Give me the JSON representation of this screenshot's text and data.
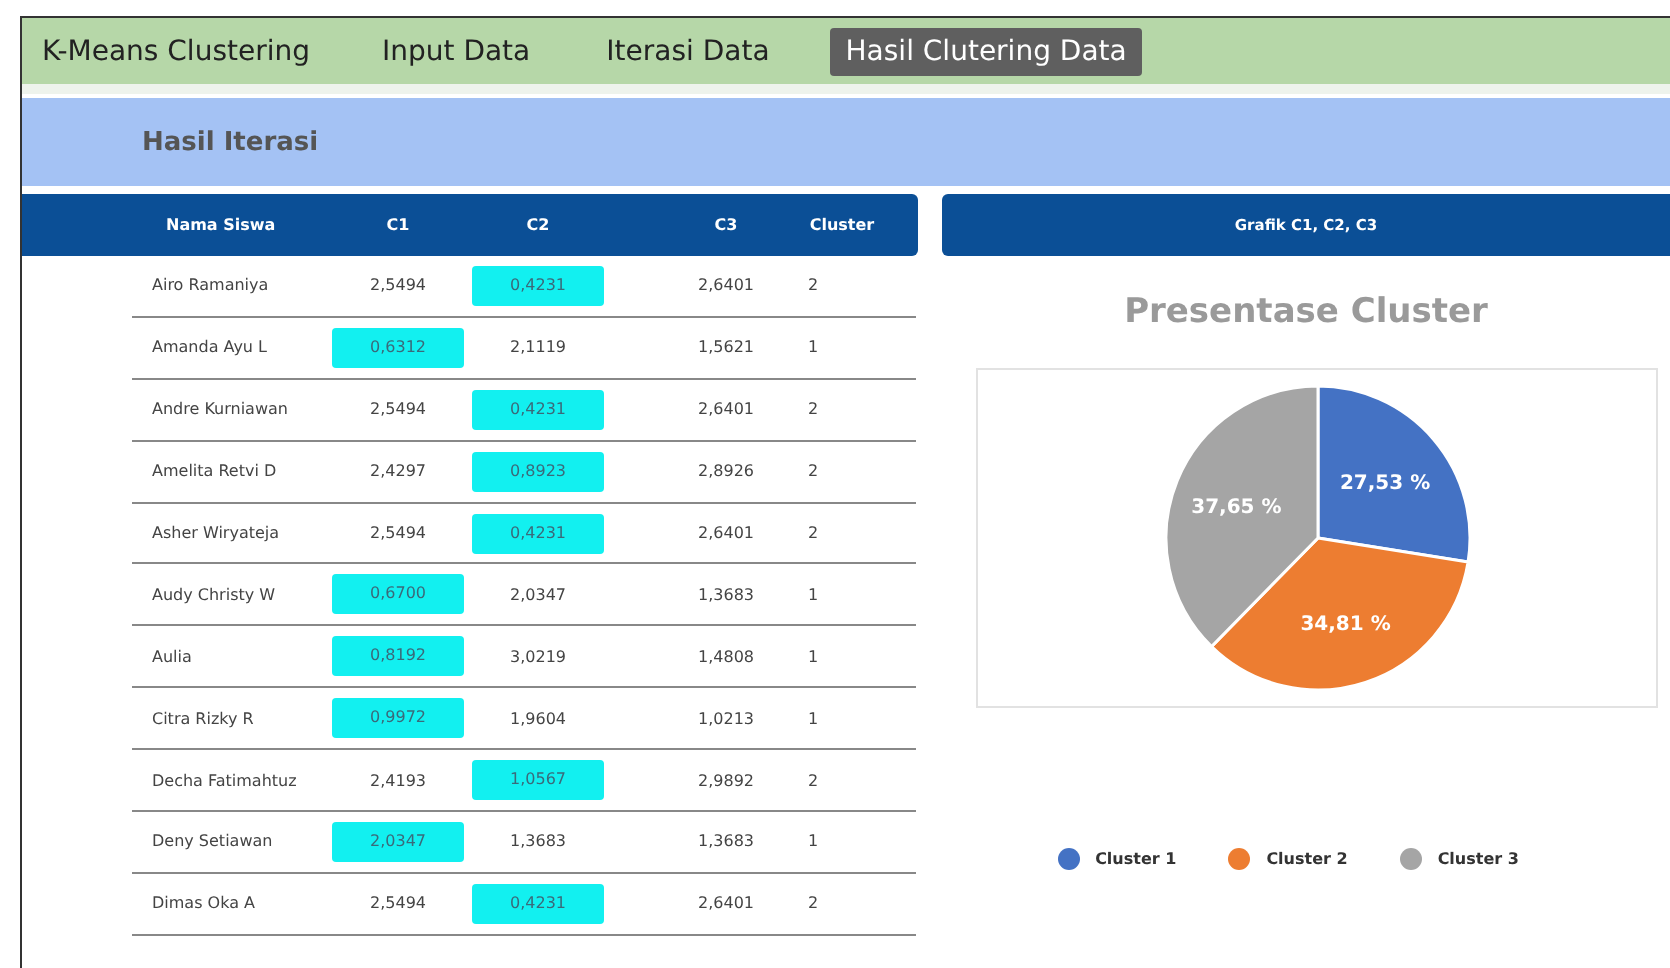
{
  "nav": {
    "brand": "K-Means Clustering",
    "tabs": [
      {
        "label": "Input Data",
        "selected": false
      },
      {
        "label": "Iterasi Data",
        "selected": false
      },
      {
        "label": "Hasil Clutering Data",
        "selected": true
      }
    ]
  },
  "section_title": "Hasil Iterasi",
  "table": {
    "columns": [
      "Nama Siswa",
      "C1",
      "C2",
      "C3",
      "Cluster"
    ],
    "rows": [
      {
        "name": "Airo Ramaniya",
        "values": [
          {
            "text": "2,5494",
            "highlighted": false
          },
          {
            "text": "0,4231",
            "highlighted": true
          },
          {
            "text": "2,6401",
            "highlighted": false
          }
        ],
        "cluster": "2"
      },
      {
        "name": "Amanda Ayu L",
        "values": [
          {
            "text": "0,6312",
            "highlighted": true
          },
          {
            "text": "2,1119",
            "highlighted": false
          },
          {
            "text": "1,5621",
            "highlighted": false
          }
        ],
        "cluster": "1"
      },
      {
        "name": "Andre Kurniawan",
        "values": [
          {
            "text": "2,5494",
            "highlighted": false
          },
          {
            "text": "0,4231",
            "highlighted": true
          },
          {
            "text": "2,6401",
            "highlighted": false
          }
        ],
        "cluster": "2"
      },
      {
        "name": "Amelita Retvi D",
        "values": [
          {
            "text": "2,4297",
            "highlighted": false
          },
          {
            "text": "0,8923",
            "highlighted": true
          },
          {
            "text": "2,8926",
            "highlighted": false
          }
        ],
        "cluster": "2"
      },
      {
        "name": "Asher Wiryateja",
        "values": [
          {
            "text": "2,5494",
            "highlighted": false
          },
          {
            "text": "0,4231",
            "highlighted": true
          },
          {
            "text": "2,6401",
            "highlighted": false
          }
        ],
        "cluster": "2"
      },
      {
        "name": "Audy Christy W",
        "values": [
          {
            "text": "0,6700",
            "highlighted": true
          },
          {
            "text": "2,0347",
            "highlighted": false
          },
          {
            "text": "1,3683",
            "highlighted": false
          }
        ],
        "cluster": "1"
      },
      {
        "name": "Aulia",
        "values": [
          {
            "text": "0,8192",
            "highlighted": true
          },
          {
            "text": "3,0219",
            "highlighted": false
          },
          {
            "text": "1,4808",
            "highlighted": false
          }
        ],
        "cluster": "1"
      },
      {
        "name": "Citra Rizky R",
        "values": [
          {
            "text": "0,9972",
            "highlighted": true
          },
          {
            "text": "1,9604",
            "highlighted": false
          },
          {
            "text": "1,0213",
            "highlighted": false
          }
        ],
        "cluster": "1"
      },
      {
        "name": "Decha Fatimahtuz",
        "values": [
          {
            "text": "2,4193",
            "highlighted": false
          },
          {
            "text": "1,0567",
            "highlighted": true
          },
          {
            "text": "2,9892",
            "highlighted": false
          }
        ],
        "cluster": "2"
      },
      {
        "name": "Deny Setiawan",
        "values": [
          {
            "text": "2,0347",
            "highlighted": true
          },
          {
            "text": "1,3683",
            "highlighted": false
          },
          {
            "text": "1,3683",
            "highlighted": false
          }
        ],
        "cluster": "1"
      },
      {
        "name": "Dimas Oka A",
        "values": [
          {
            "text": "2,5494",
            "highlighted": false
          },
          {
            "text": "0,4231",
            "highlighted": true
          },
          {
            "text": "2,6401",
            "highlighted": false
          }
        ],
        "cluster": "2"
      }
    ]
  },
  "chart_panel": {
    "header": "Grafik C1, C2, C3",
    "chart_data": {
      "type": "pie",
      "title": "Presentase Cluster",
      "categories": [
        "Cluster 1",
        "Cluster 2",
        "Cluster 3"
      ],
      "colors": [
        "#4472c4",
        "#ed7d31",
        "#a5a5a5"
      ],
      "values": [
        27.53,
        34.81,
        37.65
      ],
      "value_labels": [
        "27,53 %",
        "34,81 %",
        "37,65 %"
      ]
    }
  }
}
